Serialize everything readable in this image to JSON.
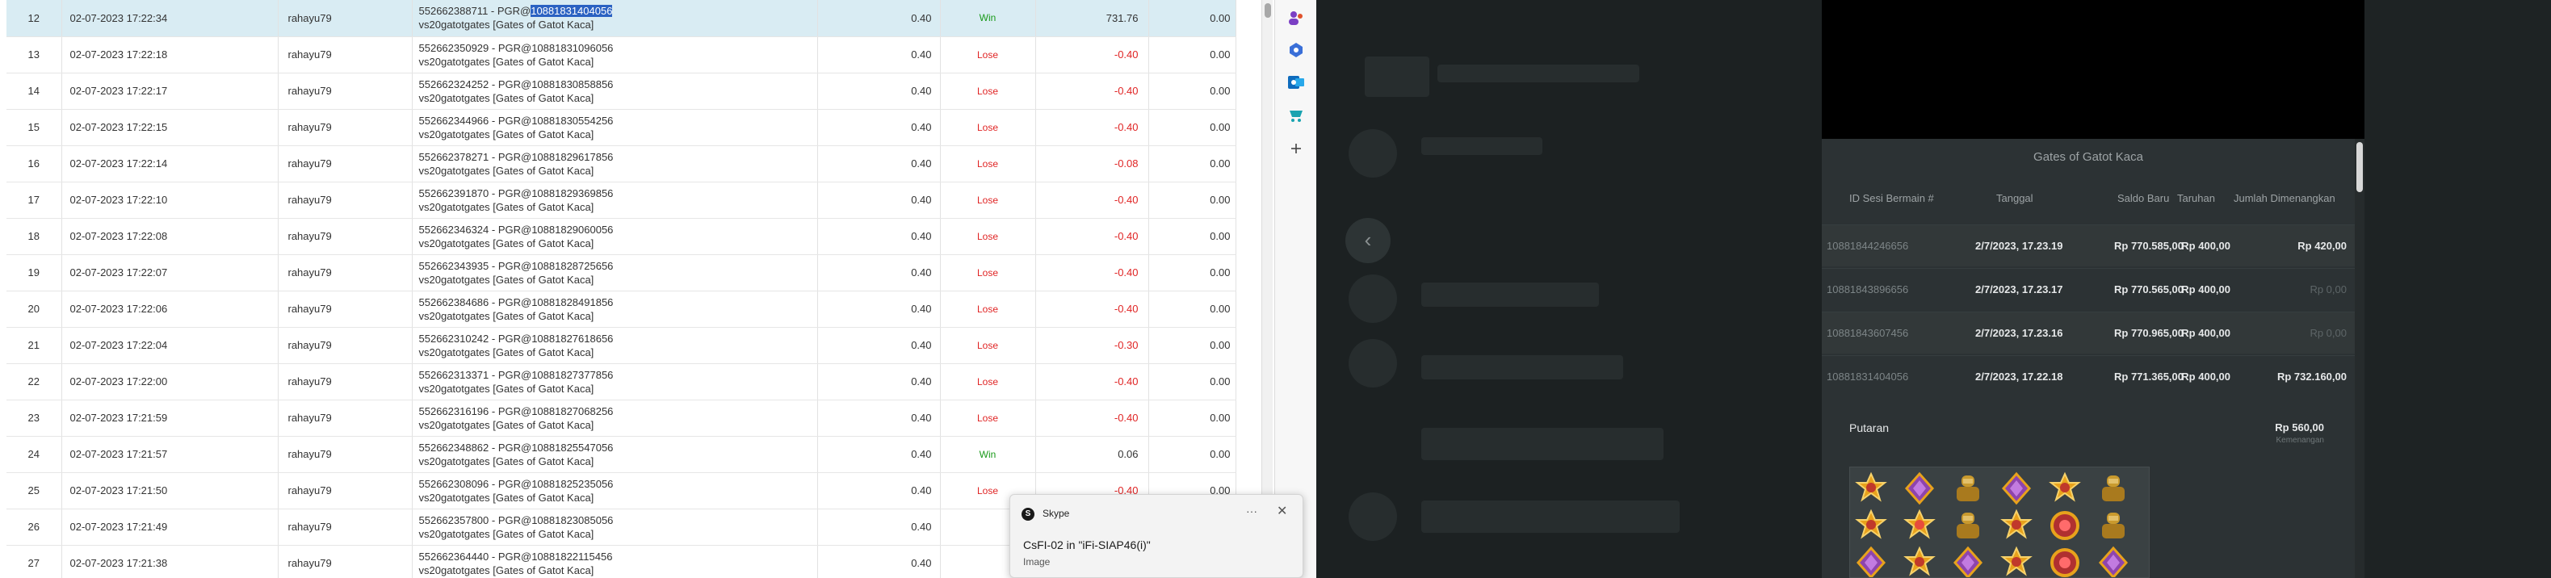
{
  "table": {
    "rows": [
      {
        "no": "12",
        "date": "02-07-2023 17:22:34",
        "user": "rahayu79",
        "desc_prefix": "552662388711 - PGR@",
        "desc_id": "10881831404056",
        "game": "vs20gatotgates [Gates of Gatot Kaca]",
        "stake": "0.40",
        "result": "Win",
        "winloss": "731.76",
        "balance": "0.00"
      },
      {
        "no": "13",
        "date": "02-07-2023 17:22:18",
        "user": "rahayu79",
        "desc_prefix": "552662350929 - PGR@",
        "desc_id": "10881831096056",
        "game": "vs20gatotgates [Gates of Gatot Kaca]",
        "stake": "0.40",
        "result": "Lose",
        "winloss": "-0.40",
        "balance": "0.00"
      },
      {
        "no": "14",
        "date": "02-07-2023 17:22:17",
        "user": "rahayu79",
        "desc_prefix": "552662324252 - PGR@",
        "desc_id": "10881830858856",
        "game": "vs20gatotgates [Gates of Gatot Kaca]",
        "stake": "0.40",
        "result": "Lose",
        "winloss": "-0.40",
        "balance": "0.00"
      },
      {
        "no": "15",
        "date": "02-07-2023 17:22:15",
        "user": "rahayu79",
        "desc_prefix": "552662344966 - PGR@",
        "desc_id": "10881830554256",
        "game": "vs20gatotgates [Gates of Gatot Kaca]",
        "stake": "0.40",
        "result": "Lose",
        "winloss": "-0.40",
        "balance": "0.00"
      },
      {
        "no": "16",
        "date": "02-07-2023 17:22:14",
        "user": "rahayu79",
        "desc_prefix": "552662378271 - PGR@",
        "desc_id": "10881829617856",
        "game": "vs20gatotgates [Gates of Gatot Kaca]",
        "stake": "0.40",
        "result": "Lose",
        "winloss": "-0.08",
        "balance": "0.00"
      },
      {
        "no": "17",
        "date": "02-07-2023 17:22:10",
        "user": "rahayu79",
        "desc_prefix": "552662391870 - PGR@",
        "desc_id": "10881829369856",
        "game": "vs20gatotgates [Gates of Gatot Kaca]",
        "stake": "0.40",
        "result": "Lose",
        "winloss": "-0.40",
        "balance": "0.00"
      },
      {
        "no": "18",
        "date": "02-07-2023 17:22:08",
        "user": "rahayu79",
        "desc_prefix": "552662346324 - PGR@",
        "desc_id": "10881829060056",
        "game": "vs20gatotgates [Gates of Gatot Kaca]",
        "stake": "0.40",
        "result": "Lose",
        "winloss": "-0.40",
        "balance": "0.00"
      },
      {
        "no": "19",
        "date": "02-07-2023 17:22:07",
        "user": "rahayu79",
        "desc_prefix": "552662343935 - PGR@",
        "desc_id": "10881828725656",
        "game": "vs20gatotgates [Gates of Gatot Kaca]",
        "stake": "0.40",
        "result": "Lose",
        "winloss": "-0.40",
        "balance": "0.00"
      },
      {
        "no": "20",
        "date": "02-07-2023 17:22:06",
        "user": "rahayu79",
        "desc_prefix": "552662384686 - PGR@",
        "desc_id": "10881828491856",
        "game": "vs20gatotgates [Gates of Gatot Kaca]",
        "stake": "0.40",
        "result": "Lose",
        "winloss": "-0.40",
        "balance": "0.00"
      },
      {
        "no": "21",
        "date": "02-07-2023 17:22:04",
        "user": "rahayu79",
        "desc_prefix": "552662310242 - PGR@",
        "desc_id": "10881827618656",
        "game": "vs20gatotgates [Gates of Gatot Kaca]",
        "stake": "0.40",
        "result": "Lose",
        "winloss": "-0.30",
        "balance": "0.00"
      },
      {
        "no": "22",
        "date": "02-07-2023 17:22:00",
        "user": "rahayu79",
        "desc_prefix": "552662313371 - PGR@",
        "desc_id": "10881827377856",
        "game": "vs20gatotgates [Gates of Gatot Kaca]",
        "stake": "0.40",
        "result": "Lose",
        "winloss": "-0.40",
        "balance": "0.00"
      },
      {
        "no": "23",
        "date": "02-07-2023 17:21:59",
        "user": "rahayu79",
        "desc_prefix": "552662316196 - PGR@",
        "desc_id": "10881827068256",
        "game": "vs20gatotgates [Gates of Gatot Kaca]",
        "stake": "0.40",
        "result": "Lose",
        "winloss": "-0.40",
        "balance": "0.00"
      },
      {
        "no": "24",
        "date": "02-07-2023 17:21:57",
        "user": "rahayu79",
        "desc_prefix": "552662348862 - PGR@",
        "desc_id": "10881825547056",
        "game": "vs20gatotgates [Gates of Gatot Kaca]",
        "stake": "0.40",
        "result": "Win",
        "winloss": "0.06",
        "balance": "0.00"
      },
      {
        "no": "25",
        "date": "02-07-2023 17:21:50",
        "user": "rahayu79",
        "desc_prefix": "552662308096 - PGR@",
        "desc_id": "10881825235056",
        "game": "vs20gatotgates [Gates of Gatot Kaca]",
        "stake": "0.40",
        "result": "Lose",
        "winloss": "-0.40",
        "balance": "0.00"
      },
      {
        "no": "26",
        "date": "02-07-2023 17:21:49",
        "user": "rahayu79",
        "desc_prefix": "552662357800 - PGR@",
        "desc_id": "10881823085056",
        "game": "vs20gatotgates [Gates of Gatot Kaca]",
        "stake": "0.40",
        "result": "",
        "winloss": "",
        "balance": "0.00"
      },
      {
        "no": "27",
        "date": "02-07-2023 17:21:38",
        "user": "rahayu79",
        "desc_prefix": "552662364440 - PGR@",
        "desc_id": "10881822115456",
        "game": "vs20gatotgates [Gates of Gatot Kaca]",
        "stake": "0.40",
        "result": "",
        "winloss": "",
        "balance": "0.00"
      }
    ]
  },
  "colors": {
    "win": "#1a9a1a",
    "lose": "#e02424",
    "selected_row": "#d9ecf3",
    "highlight": "#2b62c2"
  },
  "skype": {
    "app": "Skype",
    "title": "CsFI-02 in \"iFi-SIAP46(i)\"",
    "subtitle": "Image",
    "more_icon": "···",
    "close_icon": "✕"
  },
  "game_panel": {
    "title": "Gates of Gatot Kaca",
    "headers": {
      "session_id": "ID Sesi Bermain #",
      "date": "Tanggal",
      "balance": "Saldo Baru",
      "stake": "Taruhan",
      "win": "Jumlah Dimenangkan"
    },
    "rows": [
      {
        "id": "10881844246656",
        "date": "2/7/2023, 17.23.19",
        "balance": "Rp 770.585,00",
        "stake": "Rp 400,00",
        "win": "Rp 420,00"
      },
      {
        "id": "10881843896656",
        "date": "2/7/2023, 17.23.17",
        "balance": "Rp 770.565,00",
        "stake": "Rp 400,00",
        "win": "Rp 0,00"
      },
      {
        "id": "10881843607456",
        "date": "2/7/2023, 17.23.16",
        "balance": "Rp 770.965,00",
        "stake": "Rp 400,00",
        "win": "Rp 0,00"
      },
      {
        "id": "10881831404056",
        "date": "2/7/2023, 17.22.18",
        "balance": "Rp 771.365,00",
        "stake": "Rp 400,00",
        "win": "Rp 732.160,00"
      }
    ],
    "spin": {
      "label": "Putaran",
      "amount": "Rp 560,00",
      "sub": "Kemenangan"
    }
  },
  "back_icon": "‹"
}
